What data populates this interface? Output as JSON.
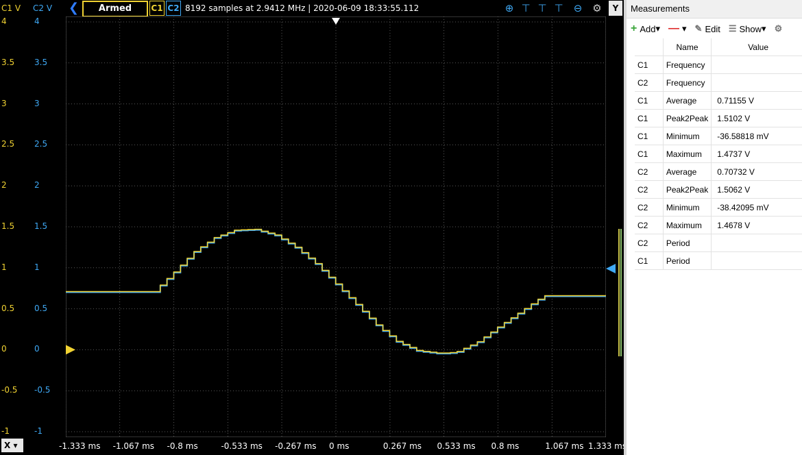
{
  "top": {
    "c1_axis_label": "C1 V",
    "c2_axis_label": "C2 V",
    "trigger_state": "Armed",
    "ch1_button": "C1",
    "ch2_button": "C2",
    "status_text": "8192 samples at 2.9412 MHz | 2020-06-09 18:33:55.112",
    "y_button": "Y",
    "x_button": "X"
  },
  "axes": {
    "c1_ticks": [
      "4",
      "3.5",
      "3",
      "2.5",
      "2",
      "1.5",
      "1",
      "0.5",
      "0",
      "-0.5",
      "-1"
    ],
    "c2_ticks": [
      "4",
      "3.5",
      "3",
      "2.5",
      "2",
      "1.5",
      "1",
      "0.5",
      "0",
      "-0.5",
      "-1"
    ],
    "x_ticks": [
      "-1.333 ms",
      "-1.067 ms",
      "-0.8 ms",
      "-0.533 ms",
      "-0.267 ms",
      "0 ms",
      "0.267 ms",
      "0.533 ms",
      "0.8 ms",
      "1.067 ms",
      "1.333 ms"
    ]
  },
  "chart_data": {
    "type": "line",
    "xlabel": "",
    "ylabel": "C1 V / C2 V",
    "xlim": [
      -1.333,
      1.333
    ],
    "ylim": [
      -1,
      4
    ],
    "grid": true,
    "series": [
      {
        "name": "C1",
        "color": "#f0d232"
      },
      {
        "name": "C2",
        "color": "#3fa9f5"
      }
    ],
    "x": [
      -1.333,
      -0.9,
      -0.8,
      -0.7,
      -0.6,
      -0.5,
      -0.4,
      -0.3,
      -0.2,
      -0.1,
      0,
      0.1,
      0.2,
      0.3,
      0.4,
      0.5,
      0.55,
      0.6,
      0.7,
      0.8,
      0.9,
      1.0,
      1.03,
      1.333
    ],
    "y": [
      0.71,
      0.71,
      0.95,
      1.2,
      1.37,
      1.46,
      1.47,
      1.4,
      1.25,
      1.05,
      0.8,
      0.55,
      0.3,
      0.1,
      -0.01,
      -0.04,
      -0.04,
      -0.02,
      0.1,
      0.28,
      0.45,
      0.62,
      0.66,
      0.66
    ]
  },
  "panel": {
    "title": "Measurements",
    "add_label": "Add",
    "edit_label": "Edit",
    "show_label": "Show",
    "col_name": "Name",
    "col_value": "Value",
    "rows": [
      {
        "ch": "C1",
        "name": "Frequency",
        "value": ""
      },
      {
        "ch": "C2",
        "name": "Frequency",
        "value": ""
      },
      {
        "ch": "C1",
        "name": "Average",
        "value": "0.71155 V"
      },
      {
        "ch": "C1",
        "name": "Peak2Peak",
        "value": "1.5102 V"
      },
      {
        "ch": "C1",
        "name": "Minimum",
        "value": "-36.58818 mV"
      },
      {
        "ch": "C1",
        "name": "Maximum",
        "value": "1.4737 V"
      },
      {
        "ch": "C2",
        "name": "Average",
        "value": "0.70732 V"
      },
      {
        "ch": "C2",
        "name": "Peak2Peak",
        "value": "1.5062 V"
      },
      {
        "ch": "C2",
        "name": "Minimum",
        "value": "-38.42095 mV"
      },
      {
        "ch": "C2",
        "name": "Maximum",
        "value": "1.4678 V"
      },
      {
        "ch": "C2",
        "name": "Period",
        "value": ""
      },
      {
        "ch": "C1",
        "name": "Period",
        "value": ""
      }
    ]
  }
}
